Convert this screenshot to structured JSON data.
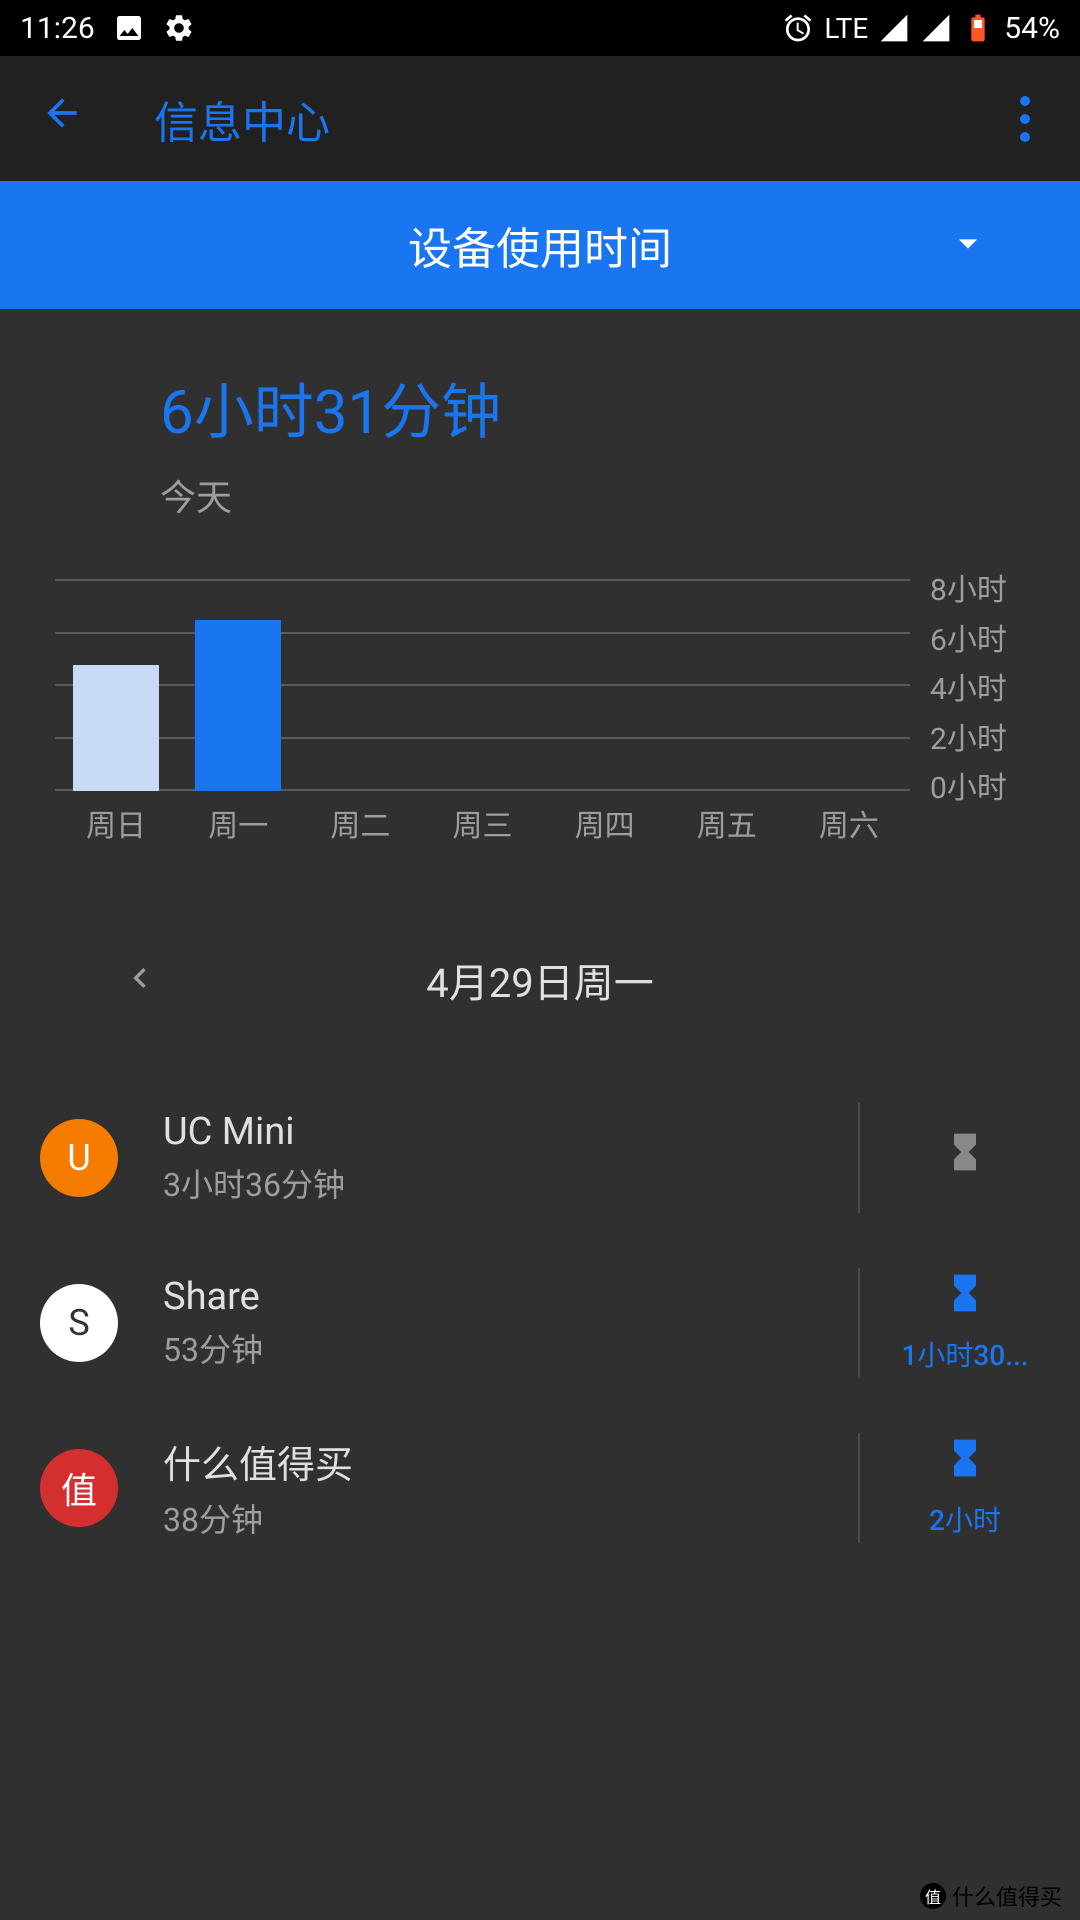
{
  "statusbar": {
    "time": "11:26",
    "network": "LTE",
    "battery": "54%"
  },
  "header": {
    "title": "信息中心"
  },
  "dropdown": {
    "label": "设备使用时间"
  },
  "summary": {
    "total_time": "6小时31分钟",
    "today_label": "今天"
  },
  "chart_data": {
    "type": "bar",
    "categories": [
      "周日",
      "周一",
      "周二",
      "周三",
      "周四",
      "周五",
      "周六"
    ],
    "values": [
      4.8,
      6.5,
      0,
      0,
      0,
      0,
      0
    ],
    "ylabel_ticks": [
      "8小时",
      "6小时",
      "4小时",
      "2小时",
      "0小时"
    ],
    "ylim": [
      0,
      8
    ],
    "selected_index": 1,
    "colors": {
      "default": "#c7d9f5",
      "selected": "#1976f0"
    }
  },
  "date_nav": {
    "date_label": "4月29日周一"
  },
  "apps": [
    {
      "name": "UC Mini",
      "time": "3小时36分钟",
      "limit": null,
      "icon_bg": "#f57c00",
      "icon_text": "U",
      "icon_color": "#fff"
    },
    {
      "name": "Share",
      "time": "53分钟",
      "limit": "1小时30...",
      "icon_bg": "#fff",
      "icon_text": "S",
      "icon_color": "#333"
    },
    {
      "name": "什么值得买",
      "time": "38分钟",
      "limit": "2小时",
      "icon_bg": "#d32f2f",
      "icon_text": "值",
      "icon_color": "#fff"
    }
  ],
  "watermark": {
    "text": "什么值得买",
    "badge": "值"
  }
}
